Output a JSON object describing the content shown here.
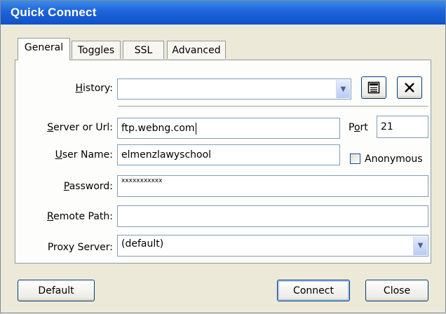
{
  "window": {
    "title": "Quick Connect"
  },
  "tabs": [
    {
      "label": "General",
      "active": true
    },
    {
      "label": "Toggles",
      "active": false
    },
    {
      "label": "SSL",
      "active": false
    },
    {
      "label": "Advanced",
      "active": false
    }
  ],
  "history": {
    "label_u": "H",
    "label_rest": "istory:",
    "value": ""
  },
  "server": {
    "label_u": "S",
    "label_rest": "erver or Url:",
    "value": "ftp.webng.com"
  },
  "port": {
    "label_pre": "P",
    "label_u": "o",
    "label_rest": "rt",
    "value": "21"
  },
  "username": {
    "label_u": "U",
    "label_rest": "ser Name:",
    "value": "elmenzlawyschool"
  },
  "anonymous": {
    "label": "Anonymous",
    "checked": false
  },
  "password": {
    "label_u": "P",
    "label_rest": "assword:",
    "value": "xxxxxxxxxxx"
  },
  "remote_path": {
    "label_u": "R",
    "label_rest": "emote Path:",
    "value": ""
  },
  "proxy": {
    "label": "Proxy Server:",
    "value": "(default)"
  },
  "buttons": {
    "default": "Default",
    "connect": "Connect",
    "close": "Close"
  },
  "icons": {
    "properties": "properties-icon",
    "delete": "delete-x-icon",
    "dropdown": "chevron-down-icon"
  }
}
